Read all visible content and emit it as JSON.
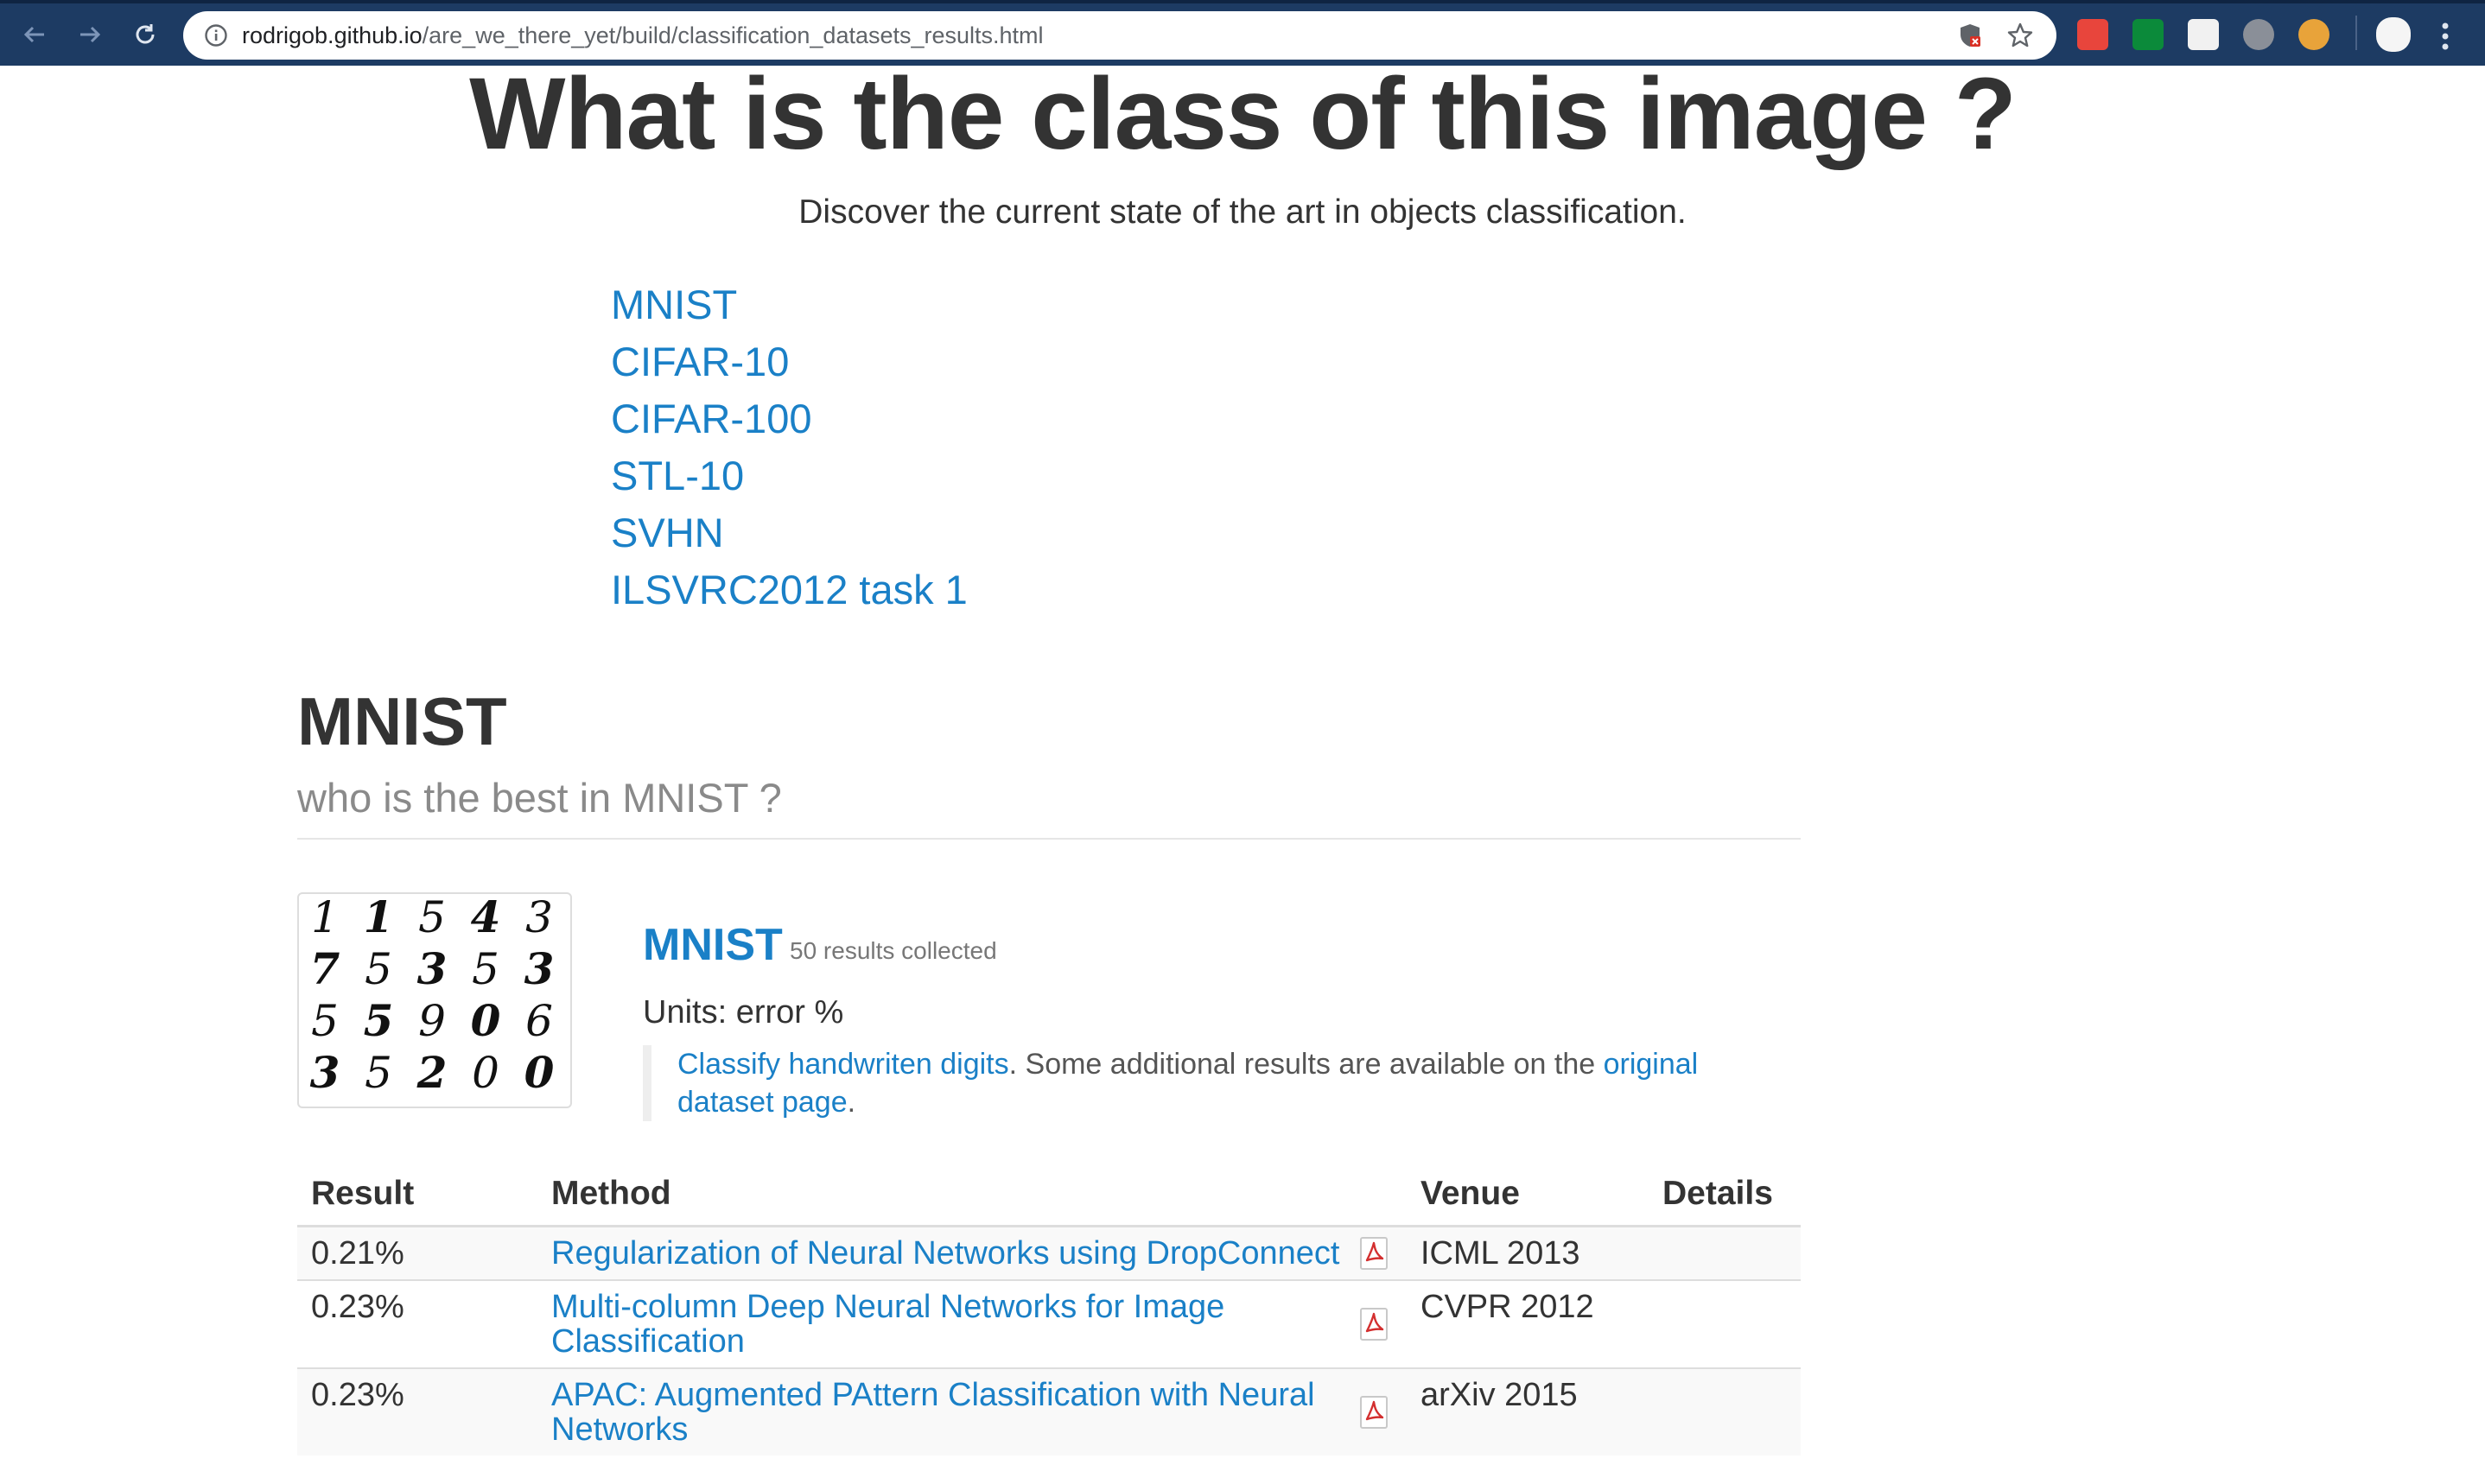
{
  "browser": {
    "url_host": "rodrigob.github.io",
    "url_path": "/are_we_there_yet/build/classification_datasets_results.html"
  },
  "page": {
    "title": "What is the class of this image ?",
    "subtitle": "Discover the current state of the art in objects classification."
  },
  "toc": [
    "MNIST",
    "CIFAR-10",
    "CIFAR-100",
    "STL-10",
    "SVHN",
    "ILSVRC2012 task 1"
  ],
  "section": {
    "title": "MNIST",
    "subtitle": "who is the best in MNIST ?",
    "dataset_name": "MNIST",
    "results_count": "50 results collected",
    "units": "Units: error %",
    "description_link": "Classify handwriten digits",
    "description_text": ". Some additional results are available on the ",
    "original_link": "original dataset page",
    "description_end": "."
  },
  "table": {
    "headers": [
      "Result",
      "Method",
      "Venue",
      "Details"
    ],
    "rows": [
      {
        "result": "0.21%",
        "method": "Regularization of Neural Networks using DropConnect",
        "venue": "ICML 2013",
        "details": ""
      },
      {
        "result": "0.23%",
        "method": "Multi-column Deep Neural Networks for Image Classification",
        "venue": "CVPR 2012",
        "details": ""
      },
      {
        "result": "0.23%",
        "method": "APAC: Augmented PAttern Classification with Neural Networks",
        "venue": "arXiv 2015",
        "details": ""
      }
    ]
  },
  "thumbnail_digits": [
    [
      "1",
      "1",
      "5",
      "4",
      "3"
    ],
    [
      "7",
      "5",
      "3",
      "5",
      "3"
    ],
    [
      "5",
      "5",
      "9",
      "0",
      "6"
    ],
    [
      "3",
      "5",
      "2",
      "0",
      "0"
    ]
  ],
  "icons": {
    "back": "arrow-left-icon",
    "forward": "arrow-right-icon",
    "reload": "reload-icon",
    "info": "info-icon",
    "shield": "shield-icon",
    "bookmark": "star-icon",
    "pdf": "pdf-icon",
    "menu": "kebab-menu-icon"
  },
  "colors": {
    "chrome": "#1d3b63",
    "link": "#1a80c7",
    "text": "#333333",
    "muted": "#8a8a8a"
  }
}
